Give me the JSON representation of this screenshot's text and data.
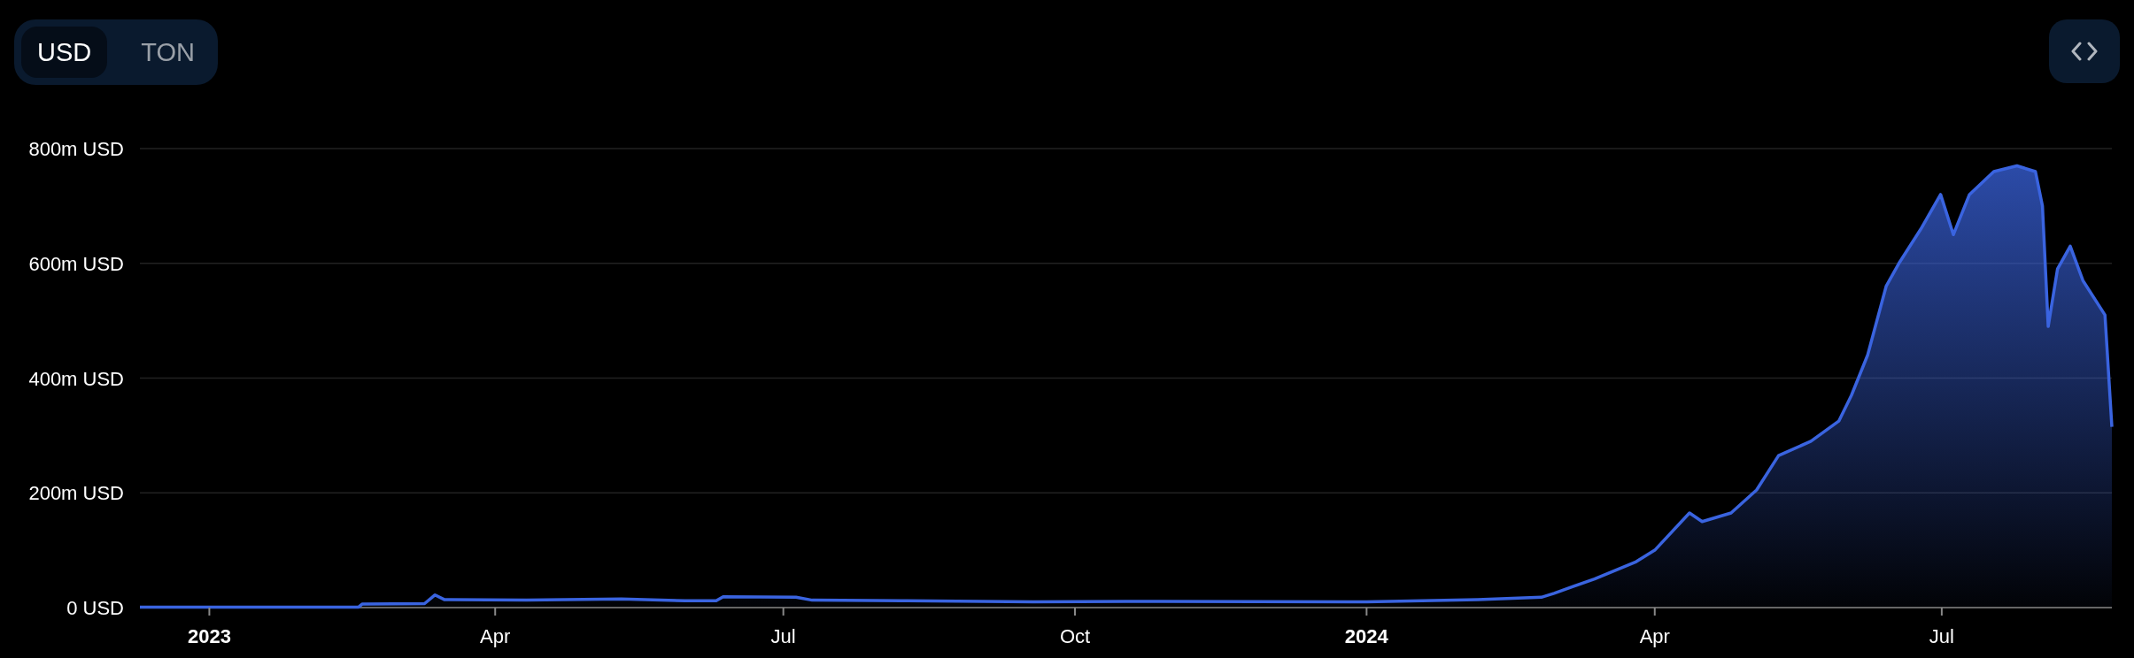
{
  "currency_toggle": [
    {
      "label": "USD",
      "selected": true
    },
    {
      "label": "TON",
      "selected": false
    }
  ],
  "chart": {
    "chart_data": {
      "type": "area",
      "grid": true,
      "xlim": [
        2022.94,
        2024.644
      ],
      "ylim": [
        0,
        800
      ],
      "xticks": [
        {
          "value": 2023,
          "label": "2023"
        },
        {
          "value": 2023.247,
          "label": "Apr"
        },
        {
          "value": 2023.496,
          "label": "Jul"
        },
        {
          "value": 2023.748,
          "label": "Oct"
        },
        {
          "value": 2024,
          "label": "2024"
        },
        {
          "value": 2024.249,
          "label": "Apr"
        },
        {
          "value": 2024.497,
          "label": "Jul"
        }
      ],
      "yticks": [
        {
          "value": 0,
          "label": "0 USD"
        },
        {
          "value": 200,
          "label": "200m USD"
        },
        {
          "value": 400,
          "label": "400m USD"
        },
        {
          "value": 600,
          "label": "600m USD"
        },
        {
          "value": 800,
          "label": "800m USD"
        }
      ],
      "x": [
        2022.94,
        2023.129,
        2023.132,
        2023.186,
        2023.195,
        2023.203,
        2023.274,
        2023.356,
        2023.411,
        2023.438,
        2023.444,
        2023.507,
        2023.521,
        2023.603,
        2023.712,
        2023.822,
        2024.0,
        2024.096,
        2024.151,
        2024.162,
        2024.197,
        2024.233,
        2024.249,
        2024.279,
        2024.29,
        2024.315,
        2024.337,
        2024.356,
        2024.384,
        2024.408,
        2024.419,
        2024.433,
        2024.449,
        2024.46,
        2024.479,
        2024.496,
        2024.507,
        2024.521,
        2024.542,
        2024.562,
        2024.578,
        2024.584,
        2024.589,
        2024.597,
        2024.608,
        2024.619,
        2024.638,
        2024.644
      ],
      "series": [
        {
          "color": "#3a64e0",
          "values": [
            1,
            1,
            6,
            7,
            22,
            14,
            13,
            15,
            12,
            12,
            19,
            18,
            13,
            12,
            10,
            11,
            10,
            14,
            18,
            25,
            50,
            80,
            100,
            165,
            150,
            165,
            205,
            265,
            290,
            325,
            370,
            440,
            560,
            600,
            660,
            720,
            650,
            720,
            760,
            770,
            760,
            700,
            490,
            590,
            630,
            570,
            510,
            315
          ]
        }
      ]
    }
  }
}
